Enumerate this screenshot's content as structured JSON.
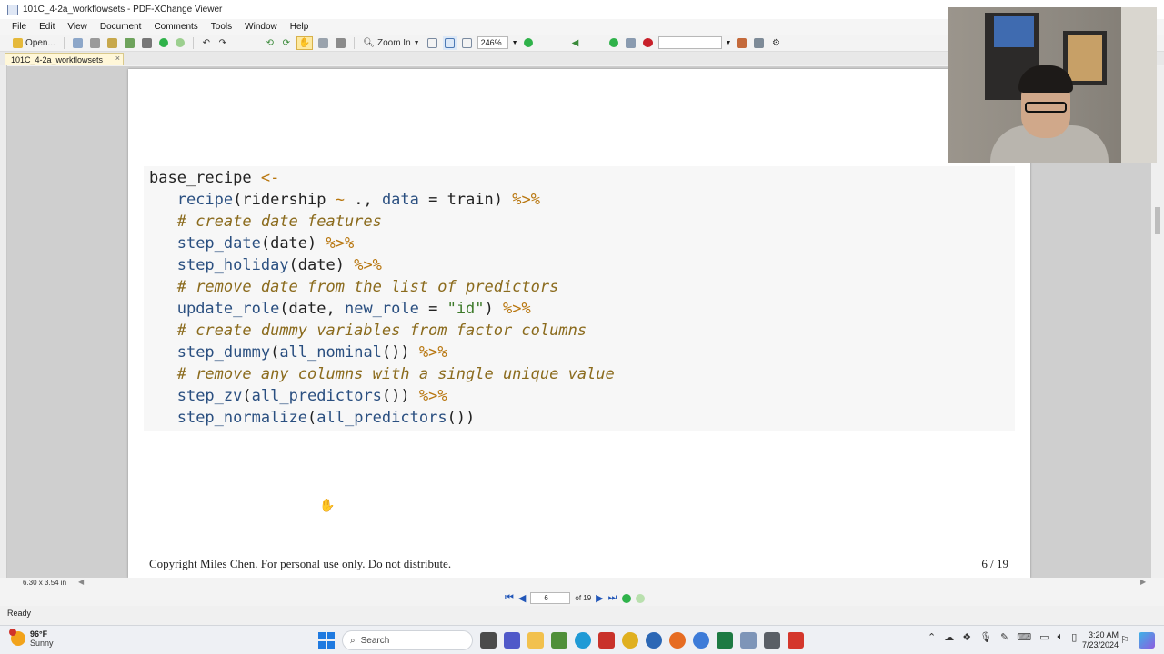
{
  "window": {
    "title": "101C_4-2a_workflowsets - PDF-XChange Viewer"
  },
  "menu": [
    "File",
    "Edit",
    "View",
    "Document",
    "Comments",
    "Tools",
    "Window",
    "Help"
  ],
  "toolbar": {
    "open_label": "Open...",
    "zoom_in_label": "Zoom In",
    "zoom_level": "246%"
  },
  "tab": {
    "label": "101C_4-2a_workflowsets",
    "close": "×"
  },
  "document": {
    "code_lines": [
      [
        {
          "t": "base_recipe ",
          "c": ""
        },
        {
          "t": "<-",
          "c": "op"
        }
      ],
      [
        {
          "t": "   ",
          "c": ""
        },
        {
          "t": "recipe",
          "c": "kw"
        },
        {
          "t": "(ridership ",
          "c": ""
        },
        {
          "t": "~",
          "c": "op"
        },
        {
          "t": " ., ",
          "c": ""
        },
        {
          "t": "data",
          "c": "kw"
        },
        {
          "t": " = train) ",
          "c": ""
        },
        {
          "t": "%>%",
          "c": "op"
        }
      ],
      [
        {
          "t": "   ",
          "c": ""
        },
        {
          "t": "# create date features",
          "c": "cm"
        }
      ],
      [
        {
          "t": "   ",
          "c": ""
        },
        {
          "t": "step_date",
          "c": "kw"
        },
        {
          "t": "(date) ",
          "c": ""
        },
        {
          "t": "%>%",
          "c": "op"
        }
      ],
      [
        {
          "t": "   ",
          "c": ""
        },
        {
          "t": "step_holiday",
          "c": "kw"
        },
        {
          "t": "(date) ",
          "c": ""
        },
        {
          "t": "%>%",
          "c": "op"
        }
      ],
      [
        {
          "t": "   ",
          "c": ""
        },
        {
          "t": "# remove date from the list of predictors",
          "c": "cm"
        }
      ],
      [
        {
          "t": "   ",
          "c": ""
        },
        {
          "t": "update_role",
          "c": "kw"
        },
        {
          "t": "(date, ",
          "c": ""
        },
        {
          "t": "new_role",
          "c": "kw"
        },
        {
          "t": " = ",
          "c": ""
        },
        {
          "t": "\"id\"",
          "c": "st"
        },
        {
          "t": ") ",
          "c": ""
        },
        {
          "t": "%>%",
          "c": "op"
        }
      ],
      [
        {
          "t": "   ",
          "c": ""
        },
        {
          "t": "# create dummy variables from factor columns",
          "c": "cm"
        }
      ],
      [
        {
          "t": "   ",
          "c": ""
        },
        {
          "t": "step_dummy",
          "c": "kw"
        },
        {
          "t": "(",
          "c": ""
        },
        {
          "t": "all_nominal",
          "c": "kw"
        },
        {
          "t": "()) ",
          "c": ""
        },
        {
          "t": "%>%",
          "c": "op"
        }
      ],
      [
        {
          "t": "   ",
          "c": ""
        },
        {
          "t": "# remove any columns with a single unique value",
          "c": "cm"
        }
      ],
      [
        {
          "t": "   ",
          "c": ""
        },
        {
          "t": "step_zv",
          "c": "kw"
        },
        {
          "t": "(",
          "c": ""
        },
        {
          "t": "all_predictors",
          "c": "kw"
        },
        {
          "t": "()) ",
          "c": ""
        },
        {
          "t": "%>%",
          "c": "op"
        }
      ],
      [
        {
          "t": "   ",
          "c": ""
        },
        {
          "t": "step_normalize",
          "c": "kw"
        },
        {
          "t": "(",
          "c": ""
        },
        {
          "t": "all_predictors",
          "c": "kw"
        },
        {
          "t": "())",
          "c": ""
        }
      ]
    ],
    "footer_left": "Copyright Miles Chen. For personal use only. Do not distribute.",
    "footer_right": "6 / 19"
  },
  "statusbar": {
    "page_size": "6.30 x 3.54 in",
    "current_page": "6",
    "page_of": "of 19",
    "status": "Ready"
  },
  "taskbar": {
    "temperature": "96°F",
    "weather": "Sunny",
    "search_placeholder": "Search",
    "time": "3:20 AM",
    "date": "7/23/2024"
  }
}
